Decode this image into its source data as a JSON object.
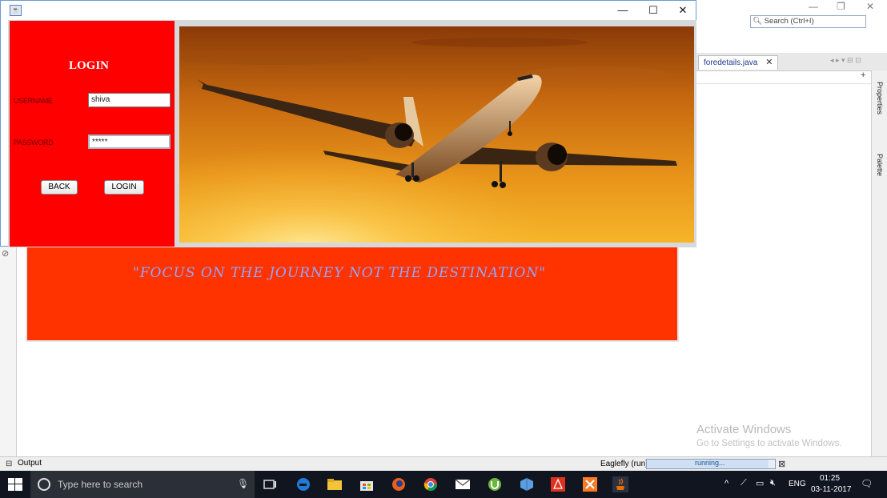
{
  "ide": {
    "search_placeholder": "Search (Ctrl+I)",
    "editor_tab": "foredetails.java",
    "editor_tab_close": "✕",
    "side_tabs": [
      "Properties",
      "Palette"
    ],
    "window_controls": [
      "—",
      "❐",
      "✕"
    ],
    "quote": "\"FOCUS ON THE JOURNEY NOT THE DESTINATION\"",
    "status": {
      "output_label": "Output",
      "run_label": "Eaglefly (run)",
      "progress_text": "running...",
      "progress_fraction": 0.95
    }
  },
  "watermark": {
    "title": "Activate Windows",
    "subtitle": "Go to Settings to activate Windows."
  },
  "login": {
    "window_controls": {
      "minimize": "—",
      "maximize": "☐",
      "close": "✕"
    },
    "title": "LOGIN",
    "username_label": "USERNAME",
    "username_value": "shiva",
    "password_label": "PASSWORD",
    "password_value": "*****",
    "back_button": "BACK",
    "login_button": "LOGIN"
  },
  "taskbar": {
    "search_placeholder": "Type here to search",
    "apps": [
      "task-view-icon",
      "edge-icon",
      "file-explorer-icon",
      "store-icon",
      "firefox-icon",
      "chrome-icon",
      "mail-icon",
      "utorrent-icon",
      "virtualbox-icon",
      "acrobat-icon",
      "xampp-icon",
      "java-icon"
    ],
    "language": "ENG",
    "time": "01:25",
    "date": "03-11-2017"
  },
  "colors": {
    "login_panel": "#ff0000",
    "banner": "#ff3300",
    "quote": "#8fa7ff",
    "taskbar": "#101520"
  }
}
